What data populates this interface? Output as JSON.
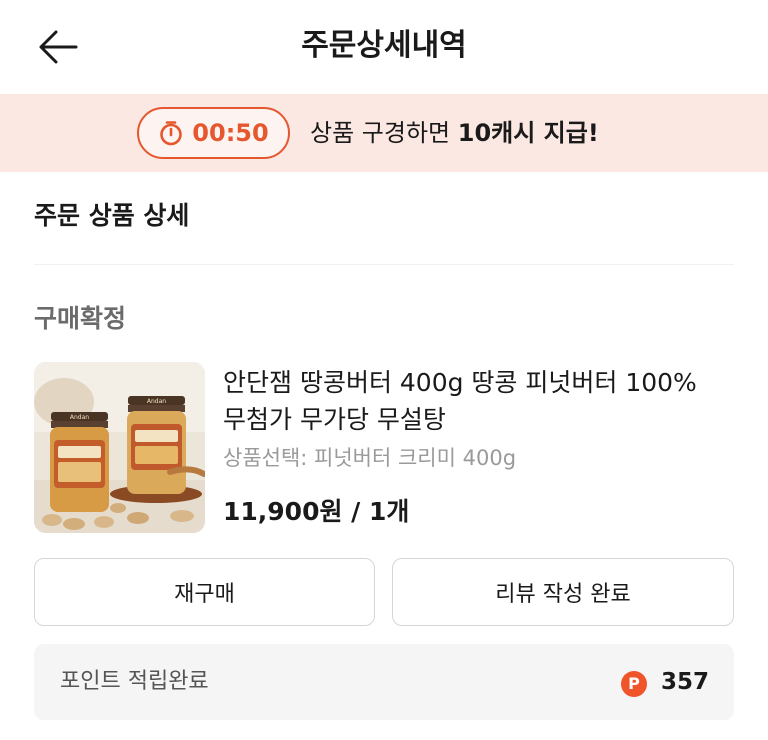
{
  "header": {
    "title": "주문상세내역",
    "back_icon": "arrow-left-icon"
  },
  "banner": {
    "timer": "00:50",
    "timer_icon": "stopwatch-icon",
    "text_prefix": "상품 구경하면 ",
    "text_bold": "10캐시 지급!",
    "accent_color": "#e5572f",
    "background_color": "#fbe8e3"
  },
  "section": {
    "title": "주문 상품 상세"
  },
  "order": {
    "status": "구매확정",
    "product": {
      "name": "안단잼 땅콩버터 400g 땅콩 피넛버터 100% 무첨가 무가당 무설탕",
      "option": "상품선택: 피넛버터 크리미 400g",
      "price": "11,900원 / 1개",
      "thumb_brand": "Andan"
    }
  },
  "actions": {
    "rebuy_label": "재구매",
    "review_label": "리뷰 작성 완료"
  },
  "points": {
    "label": "포인트 적립완료",
    "badge": "P",
    "value": "357",
    "badge_color": "#f0542a"
  }
}
